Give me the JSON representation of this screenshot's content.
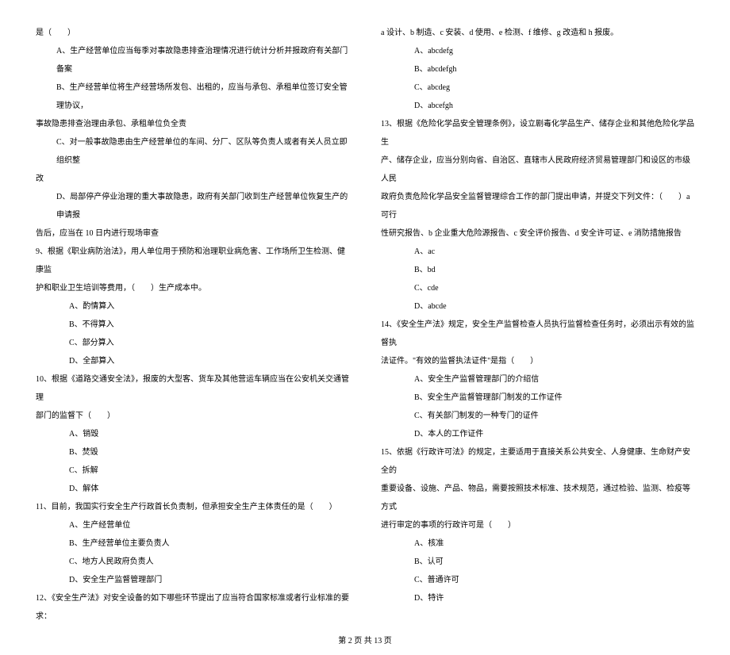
{
  "left": {
    "q8_stem_tail": "是（　　）",
    "q8_A": "A、生产经营单位应当每季对事故隐患排查治理情况进行统计分析并报政府有关部门备案",
    "q8_B_1": "B、生产经营单位将生产经营场所发包、出租的，应当与承包、承租单位签订安全管理协议，",
    "q8_B_2": "事故隐患排查治理由承包、承租单位负全责",
    "q8_C_1": "C、对一般事故隐患由生产经营单位的车间、分厂、区队等负责人或者有关人员立即组织整",
    "q8_C_2": "改",
    "q8_D_1": "D、局部停产停业治理的重大事故隐患，政府有关部门收到生产经营单位恢复生产的申请报",
    "q8_D_2": "告后，应当在 10 日内进行现场审查",
    "q9_stem_1": "9、根据《职业病防治法》，用人单位用于预防和治理职业病危害、工作场所卫生检测、健康监",
    "q9_stem_2": "护和职业卫生培训等费用，（　　）生产成本中。",
    "q9_A": "A、酌情算入",
    "q9_B": "B、不得算入",
    "q9_C": "C、部分算入",
    "q9_D": "D、全部算入",
    "q10_stem_1": "10、根据《道路交通安全法》，报废的大型客、货车及其他营运车辆应当在公安机关交通管理",
    "q10_stem_2": "部门的监督下（　　）",
    "q10_A": "A、销毁",
    "q10_B": "B、焚毁",
    "q10_C": "C、拆解",
    "q10_D": "D、解体",
    "q11_stem": "11、目前，我国实行安全生产行政首长负责制，但承担安全生产主体责任的是（　　）",
    "q11_A": "A、生产经营单位",
    "q11_B": "B、生产经营单位主要负责人",
    "q11_C": "C、地方人民政府负责人",
    "q11_D": "D、安全生产监督管理部门",
    "q12_stem": "12、《安全生产法》对安全设备的如下哪些环节提出了应当符合国家标准或者行业标准的要求："
  },
  "right": {
    "q12_options_line": "a 设计、b 制造、c 安装、d 使用、e 检测、f 维修、g 改造和 h 报废。",
    "q12_A": "A、abcdefg",
    "q12_B": "B、abcdefgh",
    "q12_C": "C、abcdeg",
    "q12_D": "D、abcefgh",
    "q13_stem_1": "13、根据《危险化学品安全管理条例》，设立剧毒化学品生产、储存企业和其他危险化学品生",
    "q13_stem_2": "产、储存企业，应当分别向省、自治区、直辖市人民政府经济贸易管理部门和设区的市级人民",
    "q13_stem_3": "政府负责危险化学品安全监督管理综合工作的部门提出申请，并提交下列文件：（　　）a 可行",
    "q13_stem_4": "性研究报告、b 企业重大危险源报告、c 安全评价报告、d 安全许可证、e 消防措施报告",
    "q13_A": "A、ac",
    "q13_B": "B、bd",
    "q13_C": "C、cde",
    "q13_D": "D、abcde",
    "q14_stem_1": "14、《安全生产法》规定，安全生产监督检查人员执行监督检查任务时，必须出示有效的监督执",
    "q14_stem_2": "法证件。\"有效的监督执法证件\"是指（　　）",
    "q14_A": "A、安全生产监督管理部门的介绍信",
    "q14_B": "B、安全生产监督管理部门制发的工作证件",
    "q14_C": "C、有关部门制发的一种专门的证件",
    "q14_D": "D、本人的工作证件",
    "q15_stem_1": "15、依据《行政许可法》的规定，主要适用于直接关系公共安全、人身健康、生命财产安全的",
    "q15_stem_2": "重要设备、设施、产品、物品，需要按照技术标准、技术规范，通过检验、监测、检疫等方式",
    "q15_stem_3": "进行审定的事项的行政许可是（　　）",
    "q15_A": "A、核准",
    "q15_B": "B、认可",
    "q15_C": "C、普通许可",
    "q15_D": "D、特许"
  },
  "footer": "第 2 页 共 13 页"
}
